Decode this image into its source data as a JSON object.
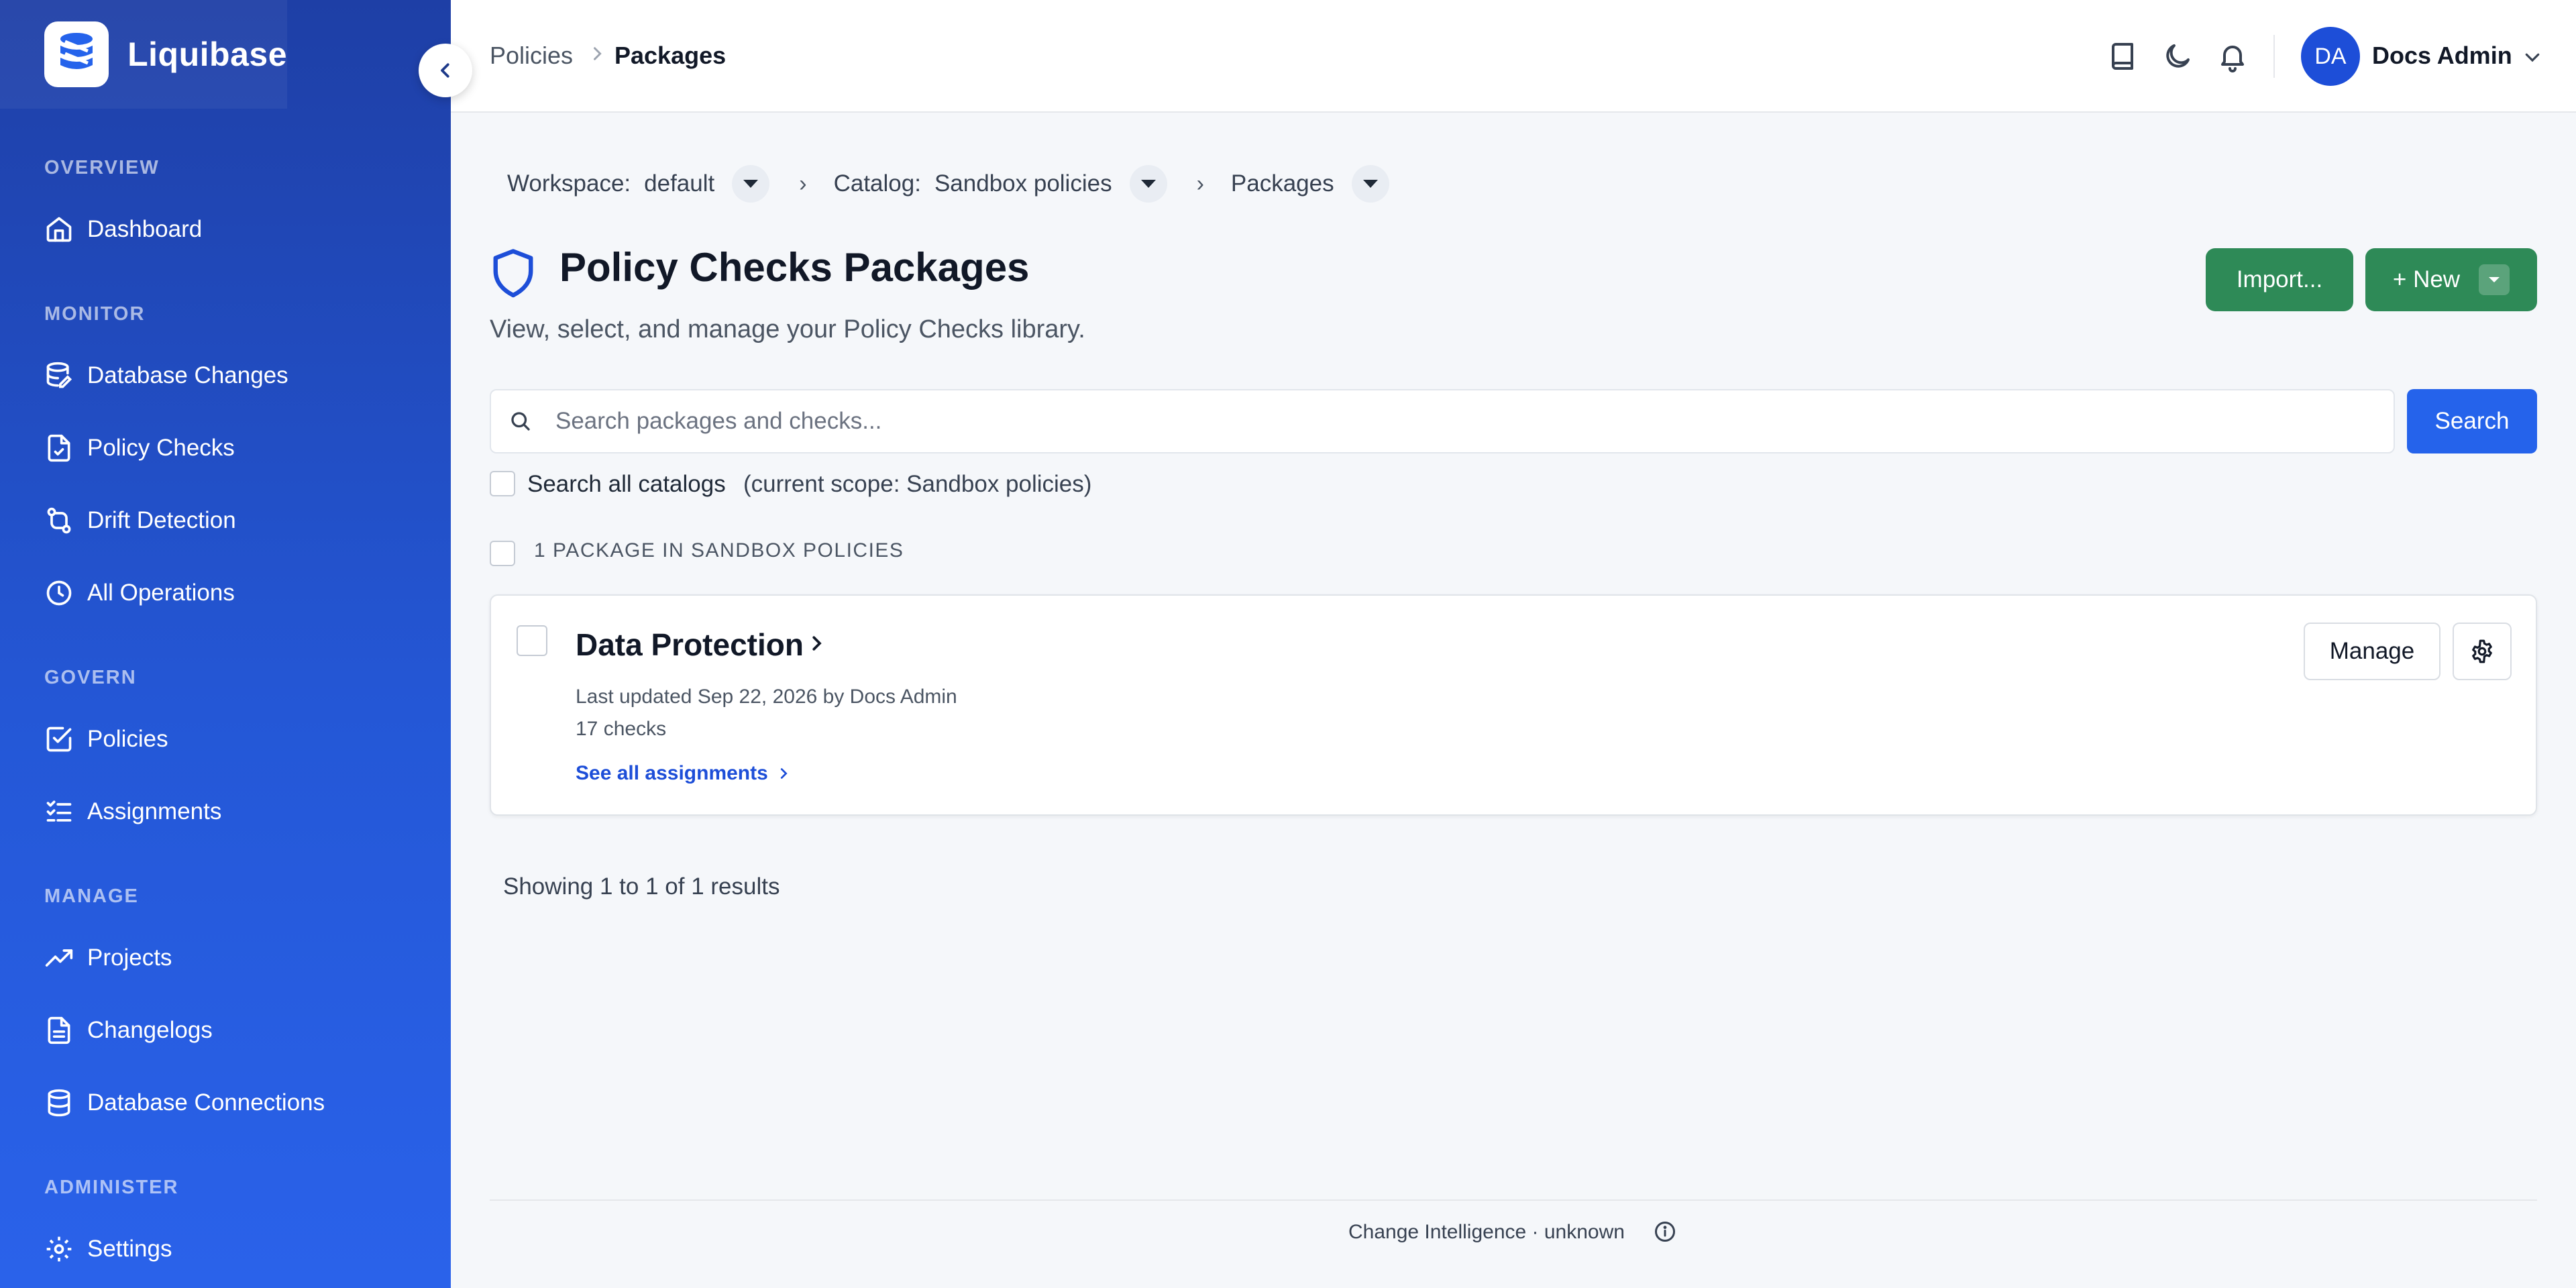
{
  "app": {
    "name": "Liquibase"
  },
  "sidebar": {
    "sections": [
      {
        "title": "OVERVIEW",
        "items": [
          {
            "label": "Dashboard",
            "icon": "home-icon"
          }
        ]
      },
      {
        "title": "MONITOR",
        "items": [
          {
            "label": "Database Changes",
            "icon": "database-edit-icon"
          },
          {
            "label": "Policy Checks",
            "icon": "file-check-icon"
          },
          {
            "label": "Drift Detection",
            "icon": "git-compare-icon"
          },
          {
            "label": "All Operations",
            "icon": "clock-icon"
          }
        ]
      },
      {
        "title": "GOVERN",
        "items": [
          {
            "label": "Policies",
            "icon": "square-check-icon"
          },
          {
            "label": "Assignments",
            "icon": "list-checks-icon"
          }
        ]
      },
      {
        "title": "MANAGE",
        "items": [
          {
            "label": "Projects",
            "icon": "trending-up-icon"
          },
          {
            "label": "Changelogs",
            "icon": "document-icon"
          },
          {
            "label": "Database Connections",
            "icon": "database-icon"
          }
        ]
      },
      {
        "title": "ADMINISTER",
        "items": [
          {
            "label": "Settings",
            "icon": "gear-icon"
          }
        ]
      }
    ]
  },
  "header": {
    "breadcrumbs": [
      "Policies",
      "Packages"
    ],
    "user": {
      "initials": "DA",
      "name": "Docs Admin"
    }
  },
  "scope": {
    "workspace_label": "Workspace:",
    "workspace_value": "default",
    "catalog_label": "Catalog:",
    "catalog_value": "Sandbox policies",
    "packages_label": "Packages"
  },
  "page": {
    "title": "Policy Checks Packages",
    "subtitle": "View, select, and manage your Policy Checks library.",
    "import_label": "Import...",
    "new_label": "+ New"
  },
  "search": {
    "placeholder": "Search packages and checks...",
    "value": "",
    "button_label": "Search",
    "all_catalogs_label": "Search all catalogs",
    "scope_note": "(current scope: Sandbox policies)"
  },
  "packages": {
    "count_label": "1 PACKAGE IN SANDBOX POLICIES",
    "items": [
      {
        "name": "Data Protection",
        "last_updated": "Last updated Sep 22, 2026 by Docs Admin",
        "checks": "17 checks",
        "link_label": "See all assignments",
        "manage_label": "Manage"
      }
    ]
  },
  "results_text": "Showing 1 to 1 of 1 results",
  "footer": {
    "text": "Change Intelligence · unknown"
  },
  "colors": {
    "sidebar_top": "#1e3fa6",
    "sidebar_bottom": "#2a62ea",
    "primary": "#2563eb",
    "success": "#2e8a57",
    "link": "#1d4ed8"
  }
}
